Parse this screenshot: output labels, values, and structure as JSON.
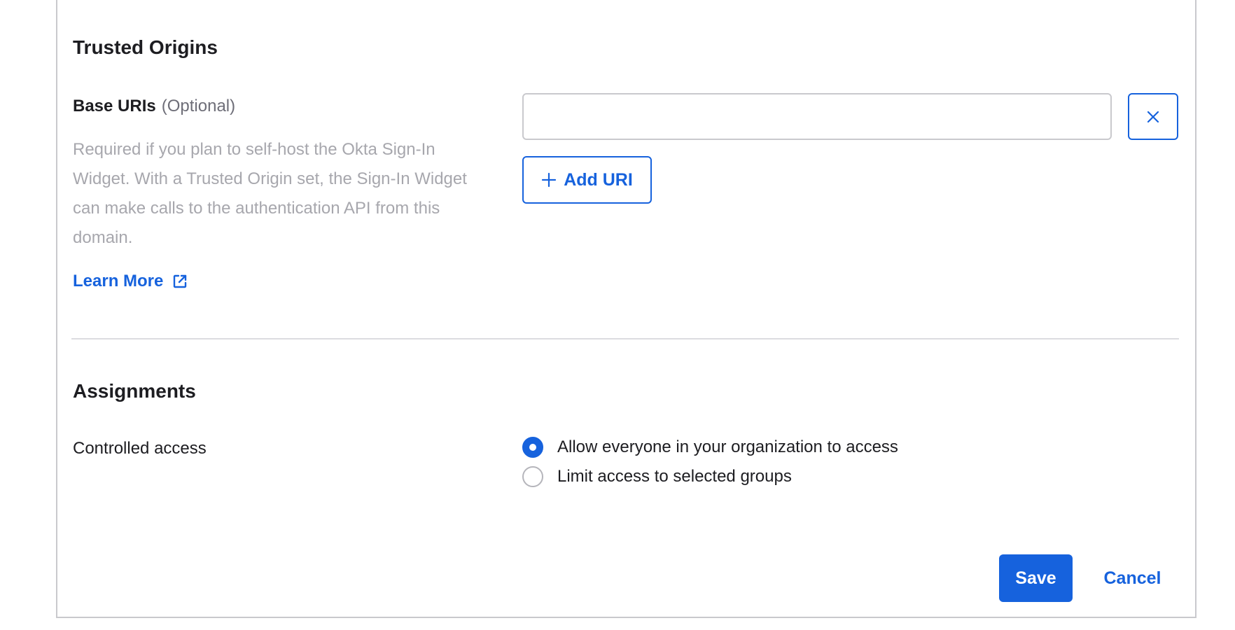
{
  "trusted_origins": {
    "title": "Trusted Origins",
    "base_uris": {
      "label": "Base URIs",
      "optional": "(Optional)",
      "help": "Required if you plan to self-host the Okta Sign-In Widget. With a Trusted Origin set, the Sign-In Widget can make calls to the authentication API from this domain.",
      "learn_more": "Learn More",
      "input_value": "",
      "add_label": "Add URI"
    }
  },
  "assignments": {
    "title": "Assignments",
    "controlled_access_label": "Controlled access",
    "options": [
      {
        "label": "Allow everyone in your organization to access",
        "checked": true
      },
      {
        "label": "Limit access to selected groups",
        "checked": false
      }
    ]
  },
  "footer": {
    "save_label": "Save",
    "cancel_label": "Cancel"
  },
  "colors": {
    "accent": "#1662dd",
    "border": "#c9c9cd",
    "help_text": "#a7a7ad"
  },
  "icons": {
    "clear": "close-icon",
    "add": "plus-icon",
    "external": "external-link-icon"
  }
}
